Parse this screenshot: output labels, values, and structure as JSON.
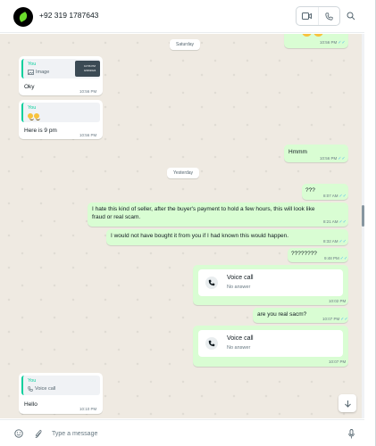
{
  "header": {
    "contact_name": "+92 319 1787643",
    "icons": [
      "app-logo-avatar",
      "video-call-icon",
      "voice-call-icon",
      "search-icon"
    ]
  },
  "chat": {
    "date_saturday": "Saturday",
    "date_yesterday": "Yesterday",
    "m1_time": "10:56 PM",
    "m2": {
      "quote_author": "You",
      "quote_body": "Image",
      "thumb_line1": "10:56 PM",
      "thumb_line2": "9/28/2024",
      "text": "Oky",
      "time": "10:56 PM"
    },
    "m3": {
      "quote_author": "You",
      "text": "Here is 9 pm",
      "time": "10:56 PM"
    },
    "m4": {
      "text": "Hmmm",
      "time": "10:56 PM"
    },
    "m5": {
      "text": "???",
      "time": "8:07 AM"
    },
    "m6": {
      "line1": "I hate this kind of seller, after the buyer's payment to hold a few hours, this will look like",
      "line2": "fraud or real scam.",
      "time": "8:21 AM"
    },
    "m7": {
      "text": "I would not have bought it from you if I had known this would happen.",
      "time": "8:32 AM"
    },
    "m8": {
      "text": "????????",
      "time": "9:48 PM"
    },
    "m9": {
      "title": "Voice call",
      "sub": "No answer",
      "time": "10:02 PM"
    },
    "m10": {
      "text": "are you real sacm?",
      "time": "10:07 PM"
    },
    "m11": {
      "title": "Voice call",
      "sub": "No answer",
      "time": "10:07 PM"
    },
    "m12": {
      "quote_author": "You",
      "quote_body": "Voice call",
      "text": "Hello",
      "time": "10:10 PM"
    }
  },
  "composer": {
    "placeholder": "Type a message"
  },
  "colors": {
    "incoming": "#ffffff",
    "outgoing": "#d9fdd3",
    "background": "#efeae2",
    "accent": "#06cf9c",
    "read_ticks": "#53bdeb"
  }
}
